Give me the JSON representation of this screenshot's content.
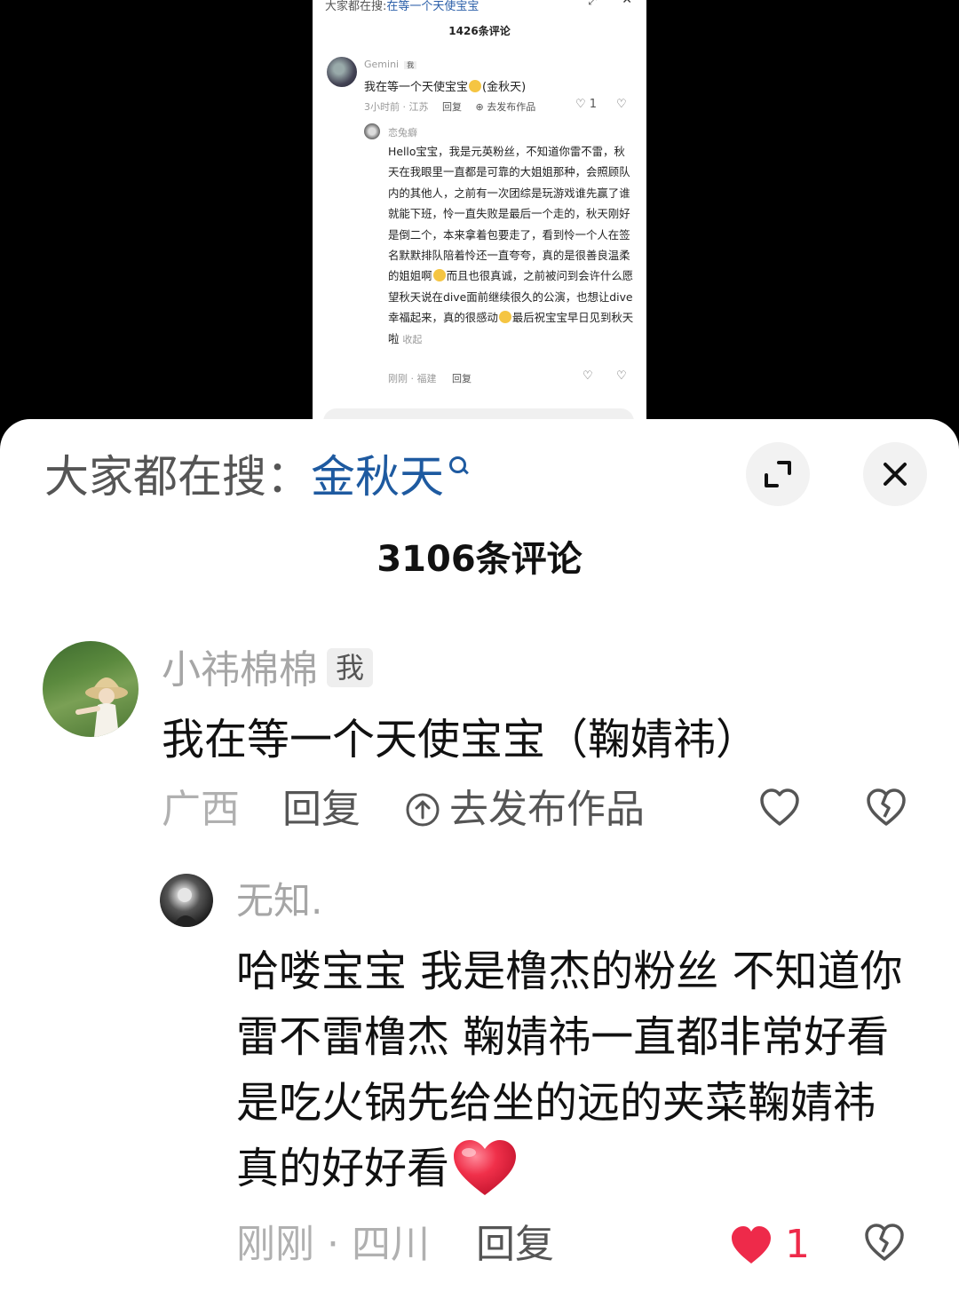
{
  "embedded_screenshot": {
    "search_label": "大家都在搜:",
    "search_keyword": "在等一个天使宝宝",
    "comment_count": "1426条评论",
    "comment": {
      "user": "Gemini",
      "me_tag": "我",
      "text_before": "我在等一个天使宝宝",
      "text_after": "(金秋天)",
      "meta_time_location": "3小时前 · 江苏",
      "reply_label": "回复",
      "publish_label": "去发布作品",
      "like_count": "1"
    },
    "reply": {
      "user": "恋兔癖",
      "text_1": "Hello宝宝，我是元英粉丝，不知道你雷不雷，秋天在我眼里一直都是可靠的大姐姐那种，会照顾队内的其他人，之前有一次团综是玩游戏谁先赢了谁就能下班，怜一直失败是最后一个走的，秋天刚好是倒二个，本来拿着包要走了，看到怜一个人在签名默默排队陪着怜还一直夸夸，真的是很善良温柔的姐姐啊",
      "text_2": "而且也很真诚，之前被问到会许什么愿望秋天说在dive面前继续很久的公演，也想让dive幸福起来，真的很感动",
      "text_3": "最后祝宝宝早日见到秋天啦",
      "fold_label": "收起",
      "meta_time_location": "刚刚 · 福建",
      "reply_label": "回复"
    }
  },
  "sheet": {
    "search_label": "大家都在搜：",
    "search_keyword": "金秋天",
    "comment_count": "3106条评论",
    "comment": {
      "user": "小祎棉棉",
      "me_tag": "我",
      "text": "我在等一个天使宝宝（鞠婧祎）",
      "location": "广西",
      "reply_label": "回复",
      "publish_label": "去发布作品"
    },
    "reply": {
      "user": "无知.",
      "text": "哈喽宝宝 我是橹杰的粉丝 不知道你雷不雷橹杰 鞠婧祎一直都非常好看 是吃火锅先给坐的远的夹菜鞠婧祎真的好好看",
      "time_location": "刚刚 · 四川",
      "reply_label": "回复",
      "like_count": "1"
    }
  },
  "colors": {
    "keyword": "#1e5aa0",
    "liked_heart": "#ee2a4a",
    "muted_text": "#a6a6a6"
  },
  "icons": [
    "search-icon",
    "expand-icon",
    "close-icon",
    "publish-icon",
    "heart-icon",
    "broken-heart-icon",
    "heart-emoji"
  ]
}
